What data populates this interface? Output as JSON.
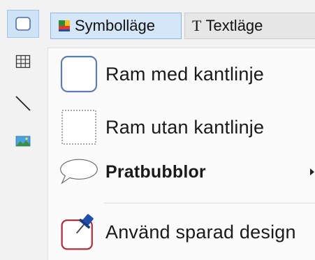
{
  "top_bar": {
    "symbol_mode_label": "Symbolläge",
    "text_mode_label": "Textläge",
    "text_mode_glyph": "T"
  },
  "left_bar": {
    "tools": [
      {
        "icon": "frame-tool-icon",
        "active": true
      },
      {
        "icon": "grid-table-icon",
        "active": false
      },
      {
        "icon": "line-tool-icon",
        "active": false
      },
      {
        "icon": "image-icon",
        "active": false
      }
    ]
  },
  "menu": {
    "items": [
      {
        "label": "Ram med kantlinje",
        "icon": "bordered-frame-icon"
      },
      {
        "label": "Ram utan kantlinje",
        "icon": "borderless-frame-icon"
      },
      {
        "label": "Pratbubblor",
        "icon": "speech-bubble-icon",
        "has_submenu": true
      },
      {
        "label": "Använd sparad design",
        "icon": "saved-design-pin-icon"
      }
    ]
  },
  "colors": {
    "active_tab_bg": "#d4e6f8",
    "active_tab_border": "#8ab8e6",
    "frame_border_blue": "#5b7fb0",
    "pin_blue": "#1f4fa8",
    "saved_frame_red": "#b03040"
  }
}
